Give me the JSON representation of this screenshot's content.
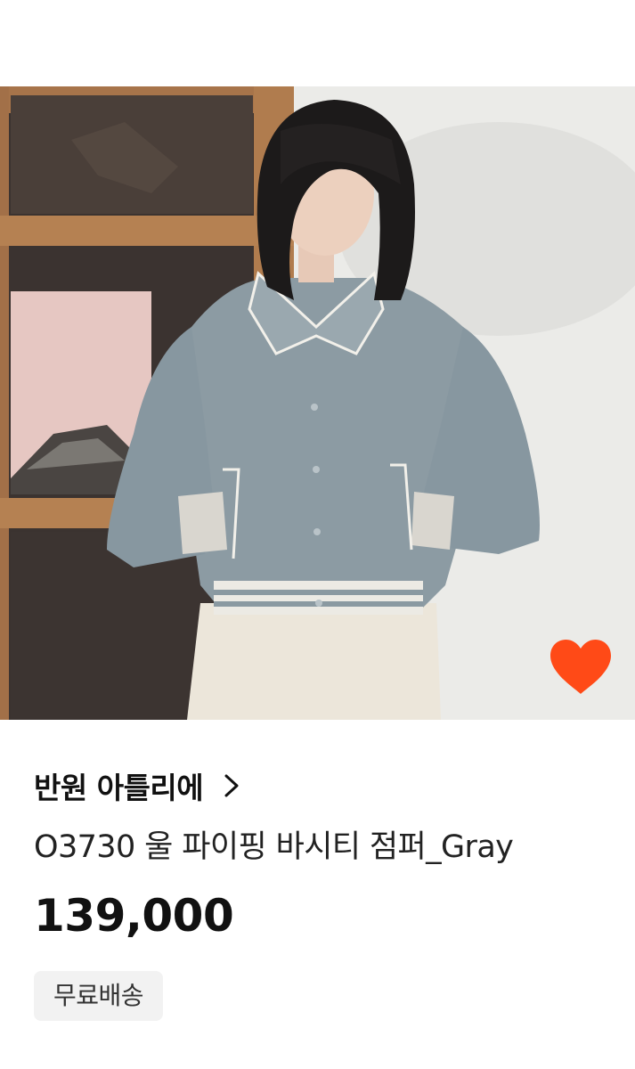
{
  "product": {
    "shop_name": "반원 아틀리에",
    "title": "O3730 울 파이핑 바시티 점퍼_Gray",
    "price": "139,000",
    "badge": "무료배송",
    "liked": true
  },
  "icons": {
    "like": "heart-icon",
    "shop_link": "chevron-right-icon"
  },
  "colors": {
    "heart": "#ff4a17",
    "badge_bg": "#f2f2f2",
    "text": "#111111"
  }
}
